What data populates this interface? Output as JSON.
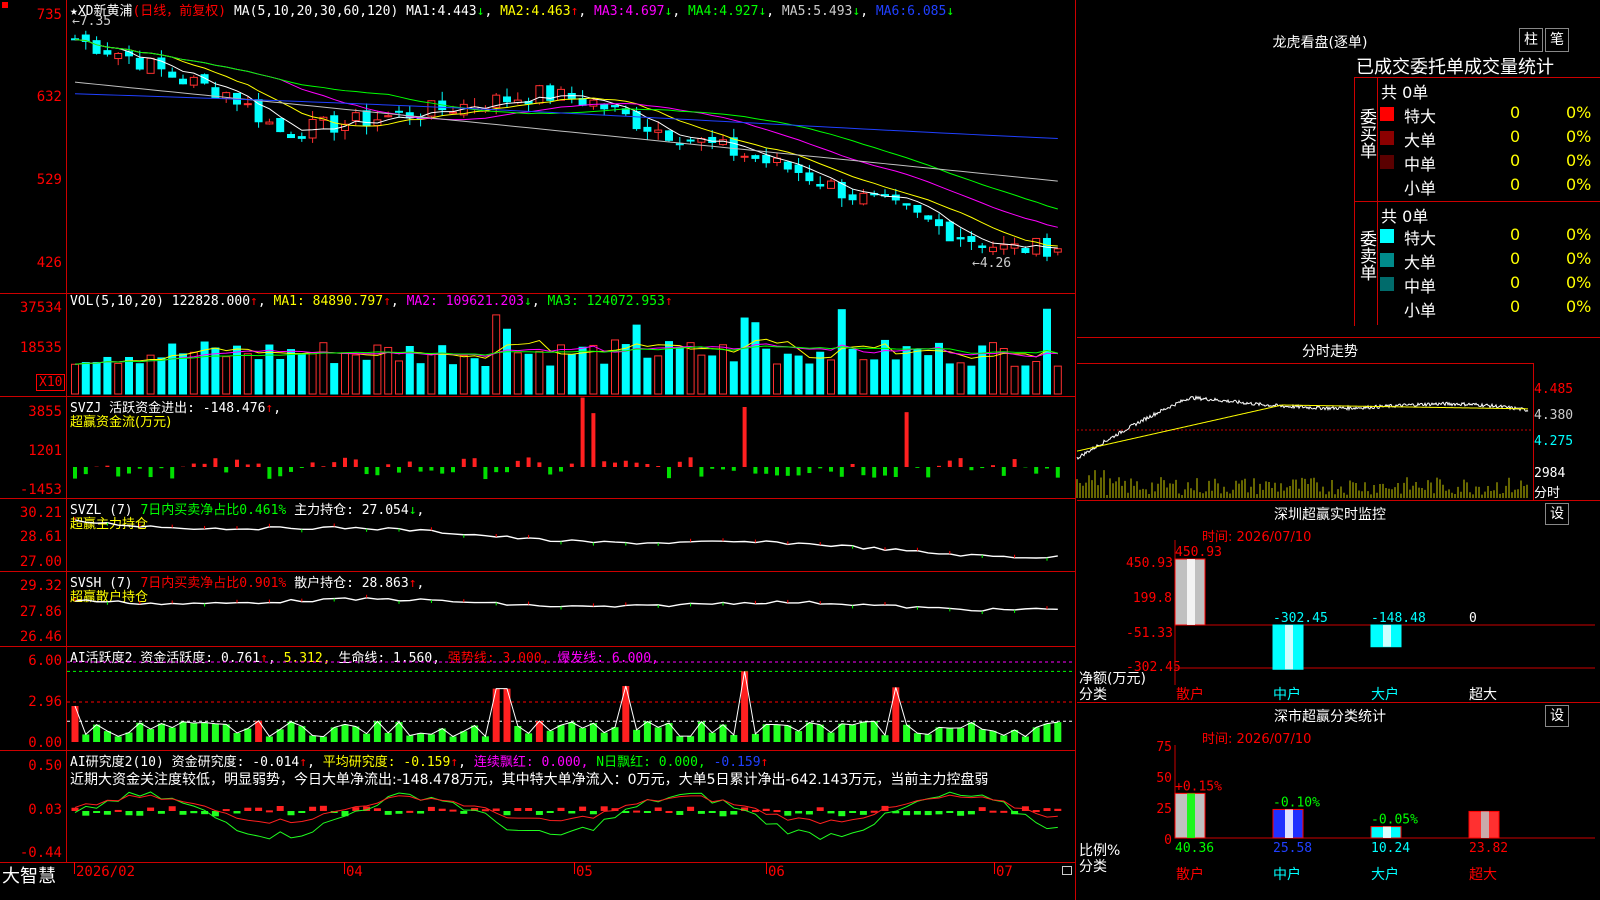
{
  "stock": {
    "name": "★XD新黄浦",
    "mode": "(日线，前复权)",
    "ma_label": "MA(5,10,20,30,60,120)",
    "ma": [
      {
        "label": "MA1:",
        "value": "4.443",
        "arrow": "↓",
        "color": "#ffffff"
      },
      {
        "label": "MA2:",
        "value": "4.463",
        "arrow": "↑",
        "color": "#ffff00"
      },
      {
        "label": "MA3:",
        "value": "4.697",
        "arrow": "↓",
        "color": "#ff00ff"
      },
      {
        "label": "MA4:",
        "value": "4.927",
        "arrow": "↓",
        "color": "#00ff00"
      },
      {
        "label": "MA5:",
        "value": "5.493",
        "arrow": "↓",
        "color": "#c0c0c0"
      },
      {
        "label": "MA6:",
        "value": "6.085",
        "arrow": "↓",
        "color": "#2040ff"
      }
    ],
    "high_marker": "←7.35",
    "low_marker": "←4.26"
  },
  "price_axis": [
    "735",
    "632",
    "529",
    "426"
  ],
  "vol": {
    "header": "VOL(5,10,20)",
    "value": "122828.000",
    "ma1": "MA1: 84890.797",
    "ma2": "MA2: 109621.203",
    "ma3": "MA3: 124072.953",
    "axis": [
      "37534",
      "18535"
    ],
    "unit": "X10"
  },
  "svzj": {
    "header": "SVZJ  活跃资金进出: -148.476",
    "sub": "超赢资金流(万元)",
    "axis": [
      "3855",
      "1201",
      "-1453"
    ]
  },
  "svzl": {
    "header_a": "SVZL (7)",
    "header_b": "7日内买卖净占比0.461%",
    "header_c": "主力持仓: 27.054",
    "sub": "超赢主力持仓",
    "axis": [
      "30.21",
      "28.61",
      "27.00"
    ]
  },
  "svsh": {
    "header_a": "SVSH (7)",
    "header_b": "7日内买卖净占比0.901%",
    "header_c": "散户持仓: 28.863",
    "sub": "超赢散户持仓",
    "axis": [
      "29.32",
      "27.86",
      "26.46"
    ]
  },
  "ai_active": {
    "header_a": "AI活跃度2 资金活跃度: 0.761",
    "header_b": "5.312,",
    "header_c": "生命线: 1.560,",
    "header_d": "强势线: 3.000,",
    "header_e": "爆发线: 6.000,",
    "axis": [
      "6.00",
      "2.96",
      "0.00"
    ]
  },
  "ai_research": {
    "header_a": "AI研究度2(10) 资金研究度: -0.014",
    "header_b": "平均研究度: -0.159",
    "header_c": "连续飘红: 0.000,",
    "header_d": "N日飘红: 0.000,",
    "header_e": "-0.159",
    "summary": "近期大资金关注度较低，明显弱势，今日大单净流出:-148.478万元，其中特大单净流入：0万元，大单5日累计净出-642.143万元，当前主力控盘弱",
    "axis": [
      "0.50",
      "0.03",
      "-0.44"
    ]
  },
  "footer": {
    "brand": "大智慧",
    "dates": [
      "2026/02",
      "04",
      "05",
      "06",
      "07"
    ]
  },
  "longhu": {
    "title": "龙虎看盘(逐单)",
    "btn_bar": "柱",
    "btn_pen": "笔",
    "stat_title": "已成交委托单成交量统计",
    "buy": {
      "side": "委买单",
      "total": "共 0单",
      "rows": [
        {
          "name": "特大",
          "val": "0",
          "pct": "0%",
          "color": "#ff0000"
        },
        {
          "name": "大单",
          "val": "0",
          "pct": "0%",
          "color": "#8b0000"
        },
        {
          "name": "中单",
          "val": "0",
          "pct": "0%",
          "color": "#5a0000"
        },
        {
          "name": "小单",
          "val": "0",
          "pct": "0%",
          "color": "#000000"
        }
      ]
    },
    "sell": {
      "side": "委卖单",
      "total": "共 0单",
      "rows": [
        {
          "name": "特大",
          "val": "0",
          "pct": "0%",
          "color": "#00ffff"
        },
        {
          "name": "大单",
          "val": "0",
          "pct": "0%",
          "color": "#008b8b"
        },
        {
          "name": "中单",
          "val": "0",
          "pct": "0%",
          "color": "#006b6b"
        },
        {
          "name": "小单",
          "val": "0",
          "pct": "0%",
          "color": "#000000"
        }
      ]
    }
  },
  "intraday": {
    "title": "分时走势",
    "axis": [
      "4.485",
      "4.380",
      "4.275"
    ],
    "vol_axis": [
      "2984",
      "分时"
    ]
  },
  "sz_monitor": {
    "title": "深圳超赢实时监控",
    "btn": "设",
    "time": "时间: 2026/07/10",
    "axis": [
      "450.93",
      "199.8",
      "-51.33",
      "-302.45"
    ],
    "ylabel": "净额(万元)",
    "xlabel": "分类",
    "categories": [
      "散户",
      "中户",
      "大户",
      "超大"
    ],
    "values": [
      "450.93",
      "-302.45",
      "-148.48",
      "0"
    ]
  },
  "sz_class": {
    "title": "深市超赢分类统计",
    "btn": "设",
    "time": "时间: 2026/07/10",
    "axis": [
      "75",
      "50",
      "25",
      "0"
    ],
    "ylabel": "比例%",
    "xlabel": "分类",
    "categories": [
      "散户",
      "中户",
      "大户",
      "超大"
    ],
    "changes": [
      "+0.15%",
      "-0.10%",
      "-0.05%",
      ""
    ],
    "values": [
      "40.36",
      "25.58",
      "10.24",
      "23.82"
    ]
  },
  "chart_data": [
    {
      "type": "candlestick",
      "title": "★XD新黄浦 (日线，前复权)",
      "ylim": [
        4.26,
        7.35
      ],
      "x": [
        "2026/02",
        "04",
        "05",
        "06",
        "07"
      ],
      "series": [
        {
          "name": "close",
          "values": [
            7.1,
            6.9,
            6.6,
            6.4,
            5.9,
            6.0,
            6.1,
            6.2,
            6.3,
            6.4,
            6.3,
            6.0,
            5.8,
            5.6,
            5.4,
            5.1,
            4.9,
            4.6,
            4.4,
            4.44
          ]
        }
      ]
    },
    {
      "type": "bar",
      "title": "VOL(5,10,20)",
      "ylim": [
        0,
        37534
      ]
    },
    {
      "type": "bar",
      "title": "超赢资金流(万元)",
      "ylim": [
        -1453,
        3855
      ]
    },
    {
      "type": "bar",
      "title": "深圳超赢实时监控",
      "categories": [
        "散户",
        "中户",
        "大户",
        "超大"
      ],
      "values": [
        450.93,
        -302.45,
        -148.48,
        0
      ],
      "ylabel": "净额(万元)",
      "ylim": [
        -302.45,
        450.93
      ]
    },
    {
      "type": "bar",
      "title": "深市超赢分类统计",
      "categories": [
        "散户",
        "中户",
        "大户",
        "超大"
      ],
      "values": [
        40.36,
        25.58,
        10.24,
        23.82
      ],
      "ylabel": "比例%",
      "ylim": [
        0,
        75
      ]
    }
  ]
}
